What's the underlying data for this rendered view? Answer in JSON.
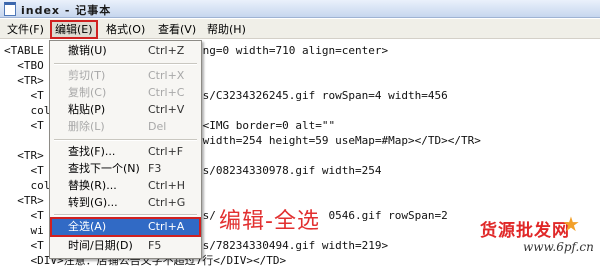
{
  "window": {
    "title": "index - 记事本"
  },
  "menubar": {
    "items": [
      "文件(F)",
      "编辑(E)",
      "格式(O)",
      "查看(V)",
      "帮助(H)"
    ]
  },
  "editor": {
    "lines": [
      "<TABLE            =0 cellPadding=0 width=710 align=center>",
      "  <TBO",
      "  <TR>",
      "    <T             nd=C:\\images/C3234326245.gif rowSpan=4 width=456",
      "    col",
      "    <T              colSpan=3><IMG border=0 alt=\"\"",
      "                   30586.gif\" width=254 height=59 useMap=#Map></TD></TR>",
      "  <TR>",
      "    <T             nd=C:\\images/08234330978.gif width=254",
      "    col            TR>",
      "  <TR>",
      "    <T             nd=C:\\images/                 0546.gif rowSpan=2",
      "    wi",
      "    <T             nd=C:\\images/78234330494.gif width=219>",
      "    <DIV>注意：店铺公告文字不超过7行</DIV></TD>"
    ]
  },
  "edit_menu": {
    "items": [
      {
        "label": "撤销(U)",
        "shortcut": "Ctrl+Z",
        "enabled": true
      },
      {
        "label": "剪切(T)",
        "shortcut": "Ctrl+X",
        "enabled": false
      },
      {
        "label": "复制(C)",
        "shortcut": "Ctrl+C",
        "enabled": false
      },
      {
        "label": "粘贴(P)",
        "shortcut": "Ctrl+V",
        "enabled": true
      },
      {
        "label": "删除(L)",
        "shortcut": "Del",
        "enabled": false
      },
      {
        "label": "查找(F)...",
        "shortcut": "Ctrl+F",
        "enabled": true
      },
      {
        "label": "查找下一个(N)",
        "shortcut": "F3",
        "enabled": true
      },
      {
        "label": "替换(R)...",
        "shortcut": "Ctrl+H",
        "enabled": true
      },
      {
        "label": "转到(G)...",
        "shortcut": "Ctrl+G",
        "enabled": true
      },
      {
        "label": "全选(A)",
        "shortcut": "Ctrl+A",
        "enabled": true,
        "selected": true
      },
      {
        "label": "时间/日期(D)",
        "shortcut": "F5",
        "enabled": true
      }
    ]
  },
  "annotation": {
    "caption": "编辑-全选"
  },
  "watermark": {
    "brand": "货源批发网",
    "url": "www.6pf.cn"
  },
  "colors": {
    "highlight": "#316ac5",
    "annotation_red": "#d02020"
  }
}
